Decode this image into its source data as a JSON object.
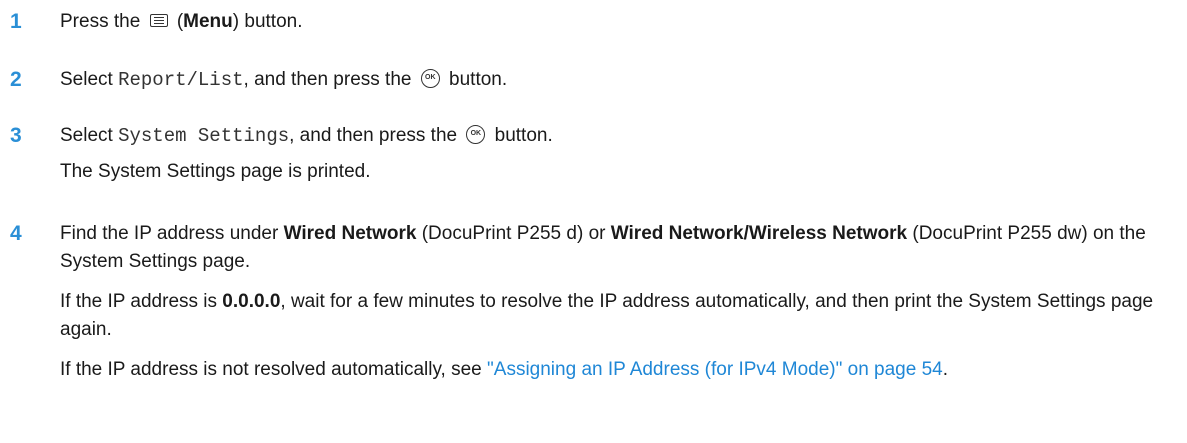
{
  "steps": [
    {
      "number": "1",
      "press_text": "Press the ",
      "open_paren": " (",
      "menu_label": "Menu",
      "close_text": ") button."
    },
    {
      "number": "2",
      "select_text": "Select ",
      "item": "Report/List",
      "then_text": ", and then press the ",
      "button_text": " button."
    },
    {
      "number": "3",
      "select_text": "Select ",
      "item": "System Settings",
      "then_text": ", and then press the ",
      "button_text": " button.",
      "result": "The System Settings page is printed."
    },
    {
      "number": "4",
      "p1_a": "Find the IP address under ",
      "p1_b": "Wired Network",
      "p1_c": " (DocuPrint P255 d) or ",
      "p1_d": "Wired Network/Wireless Network",
      "p1_e": " (DocuPrint P255 dw) on the System Settings page.",
      "p2_a": "If the IP address is ",
      "p2_b": "0.0.0.0",
      "p2_c": ", wait for a few minutes to resolve the IP address automatically, and then print the System Settings page again.",
      "p3_a": "If the IP address is not resolved automatically, see ",
      "p3_link": "\"Assigning an IP Address (for IPv4 Mode)\" on page 54",
      "p3_end": "."
    }
  ],
  "icons": {
    "menu": "menu-icon",
    "ok": "ok-icon",
    "ok_text": "OK"
  }
}
